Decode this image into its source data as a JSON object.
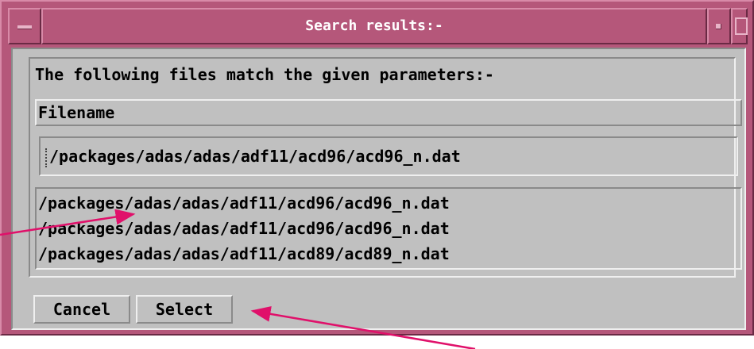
{
  "window": {
    "title": "Search results:-",
    "frame_color": "#b5577a",
    "body_color": "#c0c0c0"
  },
  "dialog": {
    "heading": "The following files match the given parameters:-",
    "column_header": "Filename",
    "selected_file": "/packages/adas/adas/adf11/acd96/acd96_n.dat",
    "files": [
      "/packages/adas/adas/adf11/acd96/acd96_n.dat",
      "/packages/adas/adas/adf11/acd96/acd96_n.dat",
      "/packages/adas/adas/adf11/acd89/acd89_n.dat"
    ]
  },
  "buttons": {
    "cancel_label": "Cancel",
    "select_label": "Select"
  },
  "annotation": {
    "arrow_color": "#e0106a"
  }
}
